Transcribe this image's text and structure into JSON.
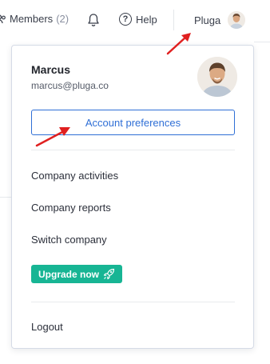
{
  "topbar": {
    "members_label": "Members",
    "members_count": "(2)",
    "help_label": "Help",
    "account_name": "Pluga"
  },
  "dropdown": {
    "user_name": "Marcus",
    "user_email": "marcus@pluga.co",
    "account_preferences": "Account preferences",
    "menu": [
      "Company activities",
      "Company reports",
      "Switch company"
    ],
    "upgrade_label": "Upgrade now",
    "logout": "Logout"
  },
  "colors": {
    "accent_blue": "#2f6fd6",
    "upgrade_green": "#17b594",
    "annotation_red": "#e02020"
  }
}
